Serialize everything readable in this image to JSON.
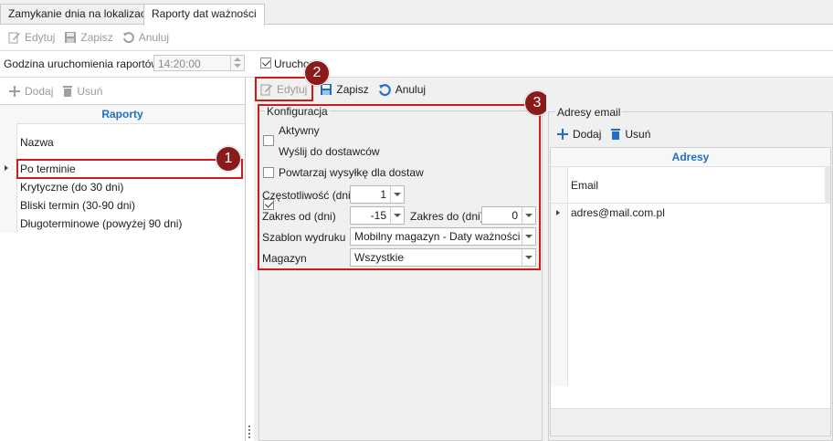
{
  "tabs": [
    {
      "label": "Zamykanie dnia na lokalizacji"
    },
    {
      "label": "Raporty dat ważności"
    }
  ],
  "toolbar_main": {
    "edit": "Edytuj",
    "save": "Zapisz",
    "cancel": "Anuluj"
  },
  "run_row": {
    "label": "Godzina uruchomienia raportów",
    "time": "14:20:00",
    "run_checkbox": "Uruchom",
    "run_checked": true
  },
  "reports_toolbar": {
    "add": "Dodaj",
    "remove": "Usuń"
  },
  "reports_grid": {
    "title": "Raporty",
    "column": "Nazwa",
    "rows": [
      "Po terminie",
      "Krytyczne (do 30 dni)",
      "Bliski termin (30-90 dni)",
      "Długoterminowe (powyżej 90 dni)"
    ]
  },
  "config_toolbar": {
    "edit": "Edytuj",
    "save": "Zapisz",
    "cancel": "Anuluj"
  },
  "config": {
    "legend": "Konfiguracja",
    "active": {
      "label": "Aktywny",
      "checked": false
    },
    "send_suppliers": {
      "label": "Wyślij do dostawców",
      "checked": false
    },
    "repeat": {
      "label": "Powtarzaj wysyłkę dla dostaw",
      "checked": true
    },
    "frequency": {
      "label": "Częstotliwość (dni)",
      "value": "1"
    },
    "range_from": {
      "label": "Zakres od (dni)",
      "value": "-15"
    },
    "range_to": {
      "label": "Zakres do (dni)",
      "value": "0"
    },
    "template": {
      "label": "Szablon wydruku",
      "value": "Mobilny magazyn - Daty ważności (..."
    },
    "warehouse": {
      "label": "Magazyn",
      "value": "Wszystkie"
    }
  },
  "email": {
    "legend": "Adresy email",
    "add": "Dodaj",
    "remove": "Usuń",
    "grid_title": "Adresy",
    "column": "Email",
    "rows": [
      "adres@mail.com.pl"
    ]
  },
  "badges": [
    "1",
    "2",
    "3"
  ],
  "colors": {
    "accent": "#1f6fc5",
    "highlight": "#d11a1a",
    "badge": "#8b1a1a"
  }
}
